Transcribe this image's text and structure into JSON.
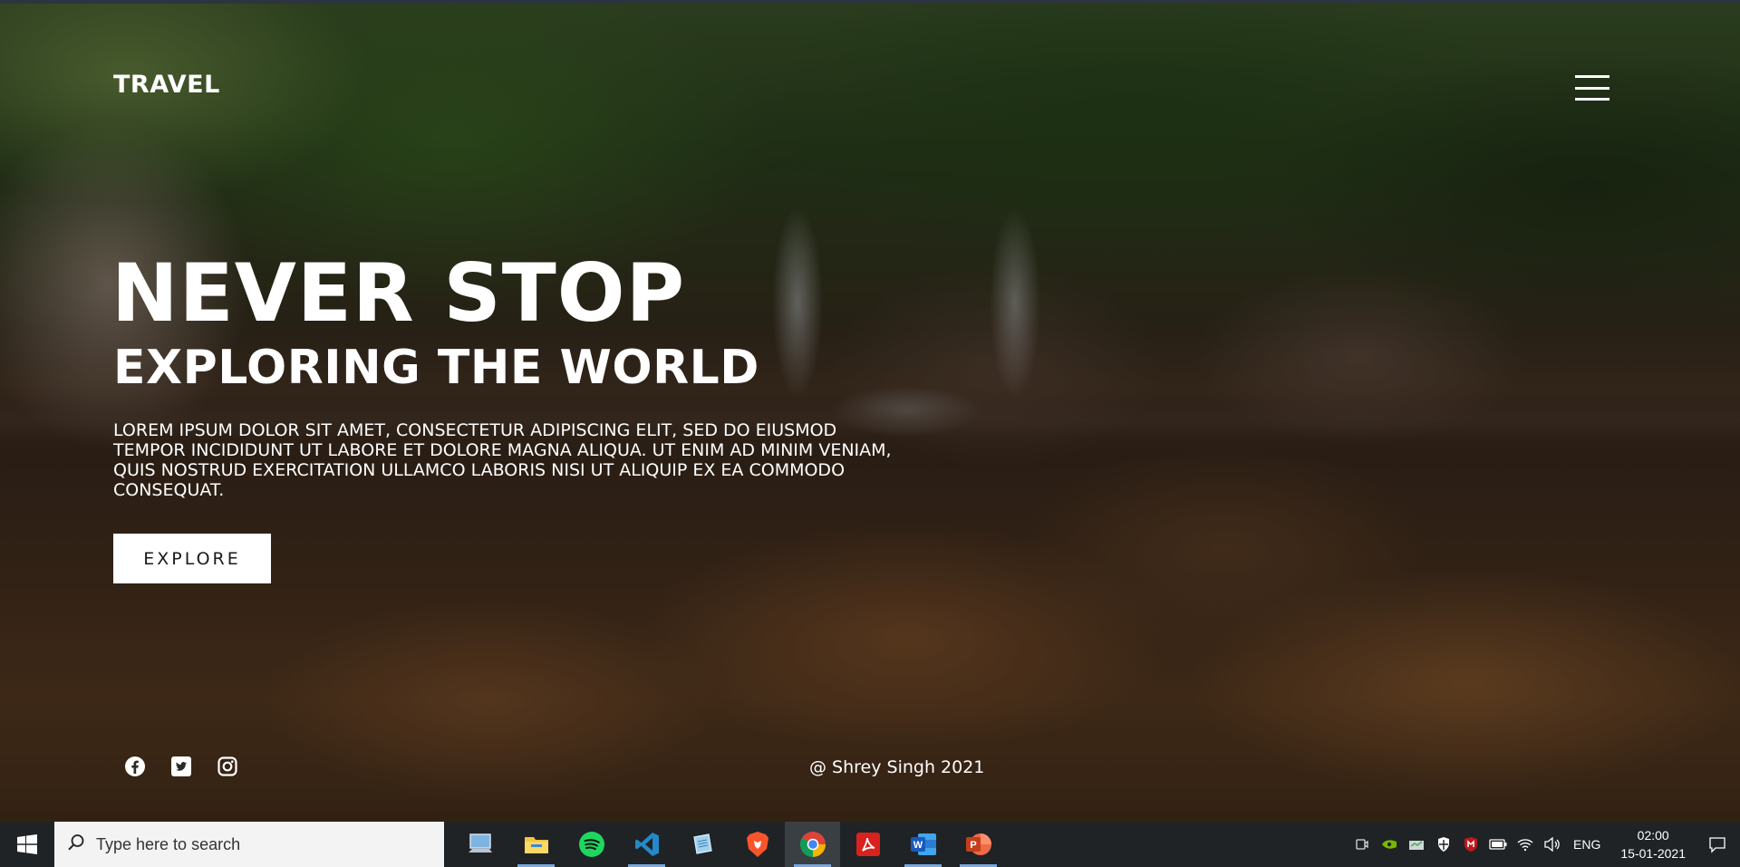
{
  "site": {
    "logo": "TRAVEL",
    "heading_line1": "NEVER STOP",
    "heading_line2": "EXPLORING THE WORLD",
    "paragraph": "Lorem ipsum dolor sit amet, consectetur adipiscing elit, sed do eiusmod tempor incididunt ut labore et dolore magna aliqua. Ut enim ad minim veniam, quis nostrud exercitation ullamco laboris nisi ut aliquip ex ea commodo consequat.",
    "cta_label": "EXPLORE",
    "social": [
      "facebook-icon",
      "twitter-icon",
      "instagram-icon"
    ],
    "copyright": "@ Shrey Singh 2021"
  },
  "taskbar": {
    "search_placeholder": "Type here to search",
    "apps": [
      {
        "name": "desktop-app-icon",
        "running": false
      },
      {
        "name": "file-explorer-icon",
        "running": true
      },
      {
        "name": "spotify-icon",
        "running": false
      },
      {
        "name": "vscode-icon",
        "running": true
      },
      {
        "name": "notepad-icon",
        "running": false
      },
      {
        "name": "brave-icon",
        "running": false
      },
      {
        "name": "chrome-icon",
        "running": true,
        "active": true
      },
      {
        "name": "acrobat-icon",
        "running": false
      },
      {
        "name": "word-icon",
        "running": true
      },
      {
        "name": "powerpoint-icon",
        "running": true
      }
    ],
    "language": "ENG",
    "time": "02:00",
    "date": "15-01-2021"
  },
  "colors": {
    "accent_running": "#7aa7d8",
    "taskbar_bg": "#1f2326"
  }
}
